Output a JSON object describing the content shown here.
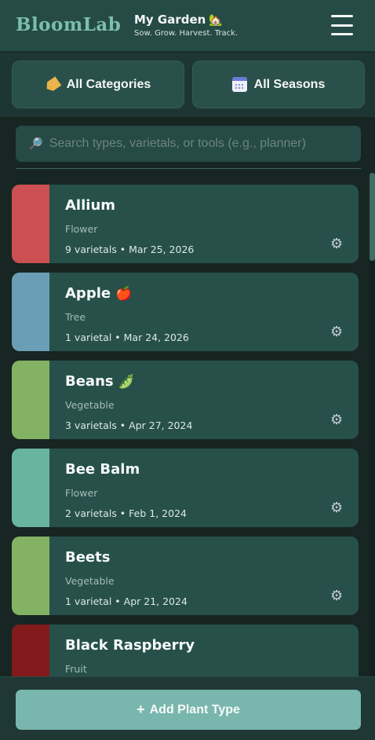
{
  "header": {
    "brand": "BloomLab",
    "garden_title": "My Garden",
    "garden_emoji": "🏡",
    "tagline": "Sow. Grow. Harvest. Track.",
    "menu_icon": "hamburger-menu-icon"
  },
  "filters": {
    "categories_label": "All Categories",
    "categories_icon": "tag-icon",
    "seasons_label": "All Seasons",
    "seasons_icon": "calendar-icon"
  },
  "search": {
    "icon": "🔎",
    "placeholder": "Search types, varietals, or tools (e.g., planner)",
    "value": ""
  },
  "plants": [
    {
      "name": "Allium",
      "emoji": "",
      "category": "Flower",
      "meta": "9 varietals • Mar 25, 2026",
      "color": "#cc4f51"
    },
    {
      "name": "Apple",
      "emoji": "🍎",
      "category": "Tree",
      "meta": "1 varietal • Mar 24, 2026",
      "color": "#6a9eb6"
    },
    {
      "name": "Beans",
      "emoji": "🫛",
      "category": "Vegetable",
      "meta": "3 varietals • Apr 27, 2024",
      "color": "#84b265"
    },
    {
      "name": "Bee Balm",
      "emoji": "",
      "category": "Flower",
      "meta": "2 varietals • Feb 1, 2024",
      "color": "#69b49c"
    },
    {
      "name": "Beets",
      "emoji": "",
      "category": "Vegetable",
      "meta": "1 varietal • Apr 21, 2024",
      "color": "#84b265"
    },
    {
      "name": "Black Raspberry",
      "emoji": "",
      "category": "Fruit",
      "meta": "",
      "color": "#821a1b"
    }
  ],
  "gear_glyph": "⚙",
  "add_button": {
    "plus": "+",
    "label": "Add Plant Type"
  }
}
